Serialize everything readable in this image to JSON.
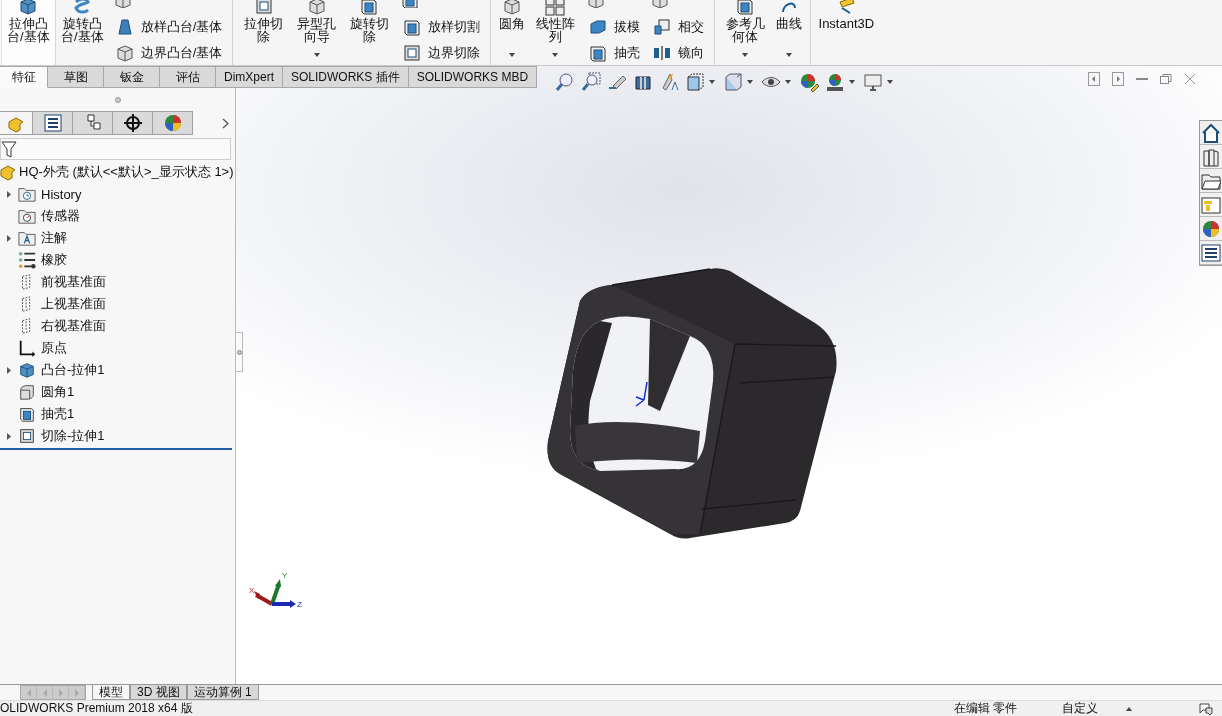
{
  "ribbon": {
    "items": [
      {
        "kind": "large",
        "label": "拉伸凸台/基体",
        "selected": true,
        "dropdown": false
      },
      {
        "kind": "large",
        "label": "旋转凸台/基体",
        "selected": false,
        "dropdown": false
      },
      {
        "kind": "stack",
        "rows": [
          "放样凸台/基体",
          "边界凸台/基体"
        ]
      },
      {
        "kind": "separator"
      },
      {
        "kind": "large",
        "label": "拉伸切除",
        "selected": false,
        "dropdown": false
      },
      {
        "kind": "large",
        "label": "异型孔向导",
        "selected": false,
        "dropdown": true
      },
      {
        "kind": "large",
        "label": "旋转切除",
        "selected": false,
        "dropdown": false
      },
      {
        "kind": "stack",
        "rows": [
          "放样切割",
          "边界切除"
        ]
      },
      {
        "kind": "separator"
      },
      {
        "kind": "large",
        "label": "圆角",
        "selected": false,
        "dropdown": true
      },
      {
        "kind": "large",
        "label": "线性阵列",
        "selected": false,
        "dropdown": true
      },
      {
        "kind": "stack",
        "rows": [
          "拔模",
          "抽壳"
        ]
      },
      {
        "kind": "stack",
        "rows": [
          "相交",
          "镜向"
        ]
      },
      {
        "kind": "separator"
      },
      {
        "kind": "large",
        "label": "参考几何体",
        "selected": false,
        "dropdown": true
      },
      {
        "kind": "large",
        "label": "曲线",
        "selected": false,
        "dropdown": true
      },
      {
        "kind": "separator"
      },
      {
        "kind": "large",
        "label": "Instant3D",
        "selected": false,
        "dropdown": false
      }
    ]
  },
  "command_tabs": [
    {
      "label": "特征",
      "selected": true
    },
    {
      "label": "草图",
      "selected": false
    },
    {
      "label": "钣金",
      "selected": false
    },
    {
      "label": "评估",
      "selected": false
    },
    {
      "label": "DimXpert",
      "selected": false
    },
    {
      "label": "SOLIDWORKS 插件",
      "selected": false
    },
    {
      "label": "SOLIDWORKS MBD",
      "selected": false
    }
  ],
  "panel_tabs": [
    {
      "selected": true
    },
    {
      "selected": false
    },
    {
      "selected": false
    },
    {
      "selected": false
    },
    {
      "selected": false
    }
  ],
  "tree": {
    "root": "HQ-外壳 (默认<<默认>_显示状态 1>)",
    "items": [
      {
        "label": "History",
        "expandable": true
      },
      {
        "label": "传感器",
        "expandable": false
      },
      {
        "label": "注解",
        "expandable": true
      },
      {
        "label": "橡胶",
        "expandable": false
      },
      {
        "label": "前视基准面",
        "expandable": false
      },
      {
        "label": "上视基准面",
        "expandable": false
      },
      {
        "label": "右视基准面",
        "expandable": false
      },
      {
        "label": "原点",
        "expandable": false
      },
      {
        "label": "凸台-拉伸1",
        "expandable": true
      },
      {
        "label": "圆角1",
        "expandable": false
      },
      {
        "label": "抽壳1",
        "expandable": false
      },
      {
        "label": "切除-拉伸1",
        "expandable": true
      }
    ]
  },
  "triad": {
    "x": "X",
    "y": "Y",
    "z": "Z"
  },
  "bottom_tabs": [
    {
      "label": "模型",
      "selected": true
    },
    {
      "label": "3D 视图",
      "selected": false
    },
    {
      "label": "运动算例 1",
      "selected": false
    }
  ],
  "status_bar": {
    "product": "OLIDWORKS Premium 2018 x64 版",
    "mode": "在编辑 零件",
    "units": "自定义"
  }
}
